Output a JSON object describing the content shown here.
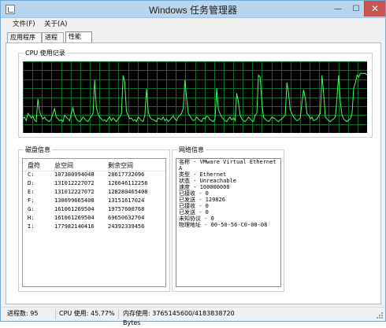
{
  "window": {
    "title": "Windows 任务管理器"
  },
  "menu": {
    "file": "文件(F)",
    "about": "关于(A)"
  },
  "tabs": [
    {
      "label": "应用程序"
    },
    {
      "label": "进程"
    },
    {
      "label": "性能"
    }
  ],
  "cpu": {
    "title": "CPU 使用记录",
    "history": [
      12,
      14,
      10,
      18,
      16,
      13,
      15,
      11,
      9,
      34,
      20,
      15,
      12,
      14,
      11,
      10,
      9,
      12,
      18,
      23,
      14,
      12,
      10,
      11,
      9,
      16,
      14,
      12,
      10,
      18,
      24,
      16,
      12,
      10,
      9,
      11,
      14,
      12,
      10,
      9,
      12,
      15,
      18,
      55,
      25,
      17,
      14,
      12,
      10,
      11,
      9,
      12,
      14,
      10,
      13,
      11,
      9,
      12,
      14,
      18,
      60,
      52,
      20,
      16,
      12,
      13,
      10,
      11,
      9,
      14,
      12,
      10,
      9,
      16,
      45,
      20,
      14,
      12,
      11,
      10,
      9,
      13,
      12,
      11,
      14,
      10,
      12,
      9,
      11,
      13,
      15,
      12,
      10,
      14,
      16,
      18,
      24,
      55,
      35,
      18,
      15,
      12,
      10,
      11,
      14,
      12,
      10,
      9,
      13,
      12,
      15,
      14,
      11,
      10,
      9,
      12,
      46,
      22,
      18,
      14,
      12,
      10,
      9,
      12,
      14,
      11,
      13,
      10,
      40,
      30,
      16,
      12,
      10,
      9,
      11,
      14,
      12,
      10,
      9,
      16,
      18,
      60,
      58,
      30,
      14,
      12,
      10,
      9,
      11,
      14,
      13,
      12,
      10,
      9,
      11,
      12,
      14,
      16,
      52,
      40,
      22,
      18,
      14,
      12,
      10,
      11,
      13,
      30,
      44,
      35,
      18,
      16,
      12,
      14,
      10,
      11,
      12,
      15,
      18,
      60,
      40,
      14,
      12,
      10,
      9,
      11,
      12,
      14,
      35,
      60,
      30,
      16,
      12,
      10,
      9,
      11,
      12,
      18,
      46,
      52,
      60,
      58,
      62,
      62,
      62,
      62,
      60
    ]
  },
  "disk": {
    "title": "磁盘信息",
    "headers": [
      "盘符",
      "总空间",
      "剩余空间"
    ],
    "rows": [
      [
        "C:",
        "107380994048",
        "28617732096"
      ],
      [
        "D:",
        "131012227072",
        "126646112256"
      ],
      [
        "E:",
        "131012227072",
        "128280465408"
      ],
      [
        "F:",
        "130699665408",
        "13151617024"
      ],
      [
        "G:",
        "161061269504",
        "19757600768"
      ],
      [
        "H:",
        "161061269504",
        "69650632704"
      ],
      [
        "I:",
        "177982140416",
        "24392339456"
      ]
    ]
  },
  "network": {
    "title": "网络信息",
    "lines": [
      "名称 - VMware Virtual Ethernet A",
      "类型 - Ethernet",
      "状态 - Unreachable",
      "速度 - 100000000",
      "已接收 - 0",
      "已发送 - 129826",
      "已接收 - 0",
      "已发送 - 0",
      "未知协议 - 0",
      "物理地址 - 00-50-56-C0-00-08"
    ]
  },
  "status": {
    "process_count": "进程数: 95",
    "cpu_usage": "CPU 使用: 45.77%",
    "memory_usage": "内存使用: 3765145600/4183838720 Bytes"
  }
}
